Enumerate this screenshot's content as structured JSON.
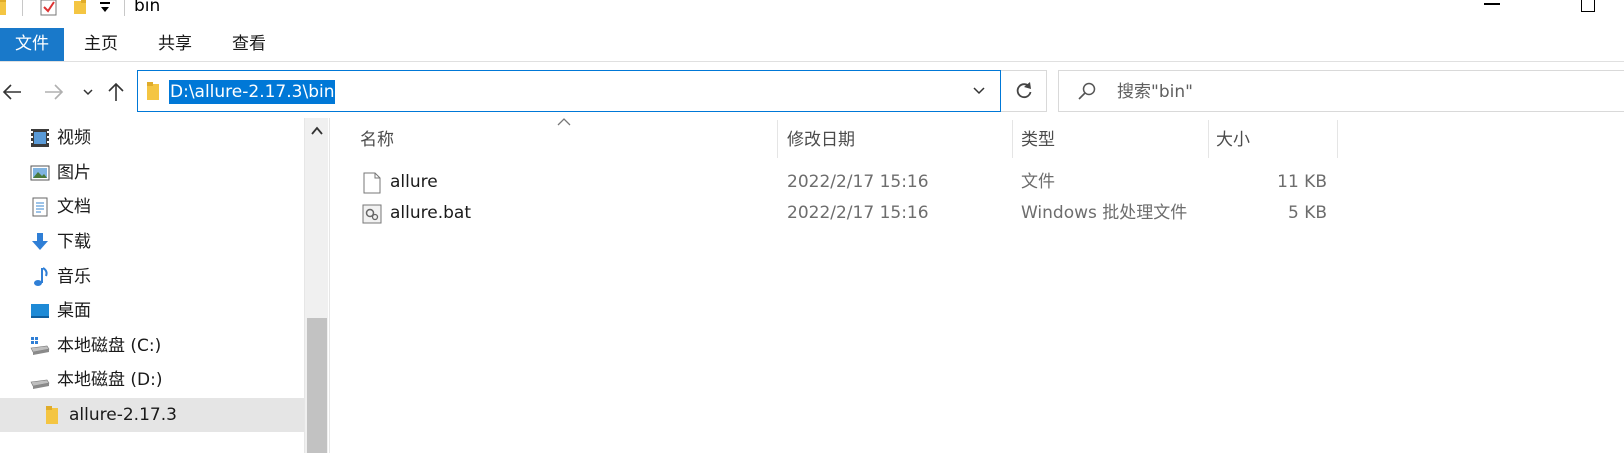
{
  "window": {
    "title": "bin"
  },
  "ribbon": {
    "tabs": [
      {
        "label": "文件",
        "active": true
      },
      {
        "label": "主页",
        "active": false
      },
      {
        "label": "共享",
        "active": false
      },
      {
        "label": "查看",
        "active": false
      }
    ]
  },
  "address": {
    "path": "D:\\allure-2.17.3\\bin"
  },
  "search": {
    "placeholder": "搜索\"bin\""
  },
  "nav_pane": {
    "items": [
      {
        "label": "视频",
        "icon": "video-icon"
      },
      {
        "label": "图片",
        "icon": "pictures-icon"
      },
      {
        "label": "文档",
        "icon": "documents-icon"
      },
      {
        "label": "下载",
        "icon": "download-icon"
      },
      {
        "label": "音乐",
        "icon": "music-icon"
      },
      {
        "label": "桌面",
        "icon": "desktop-icon"
      },
      {
        "label": "本地磁盘 (C:)",
        "icon": "drive-c-icon"
      },
      {
        "label": "本地磁盘 (D:)",
        "icon": "drive-d-icon"
      },
      {
        "label": "allure-2.17.3",
        "icon": "folder-icon",
        "selected": true
      }
    ]
  },
  "file_list": {
    "columns": {
      "name": "名称",
      "modified": "修改日期",
      "type": "类型",
      "size": "大小"
    },
    "rows": [
      {
        "name": "allure",
        "modified": "2022/2/17 15:16",
        "type": "文件",
        "size": "11 KB",
        "icon": "file-icon"
      },
      {
        "name": "allure.bat",
        "modified": "2022/2/17 15:16",
        "type": "Windows 批处理文件",
        "size": "5 KB",
        "icon": "batch-file-icon"
      }
    ]
  },
  "colors": {
    "accent": "#1979ca",
    "selection": "#0078d7",
    "folder": "#f4c542"
  }
}
